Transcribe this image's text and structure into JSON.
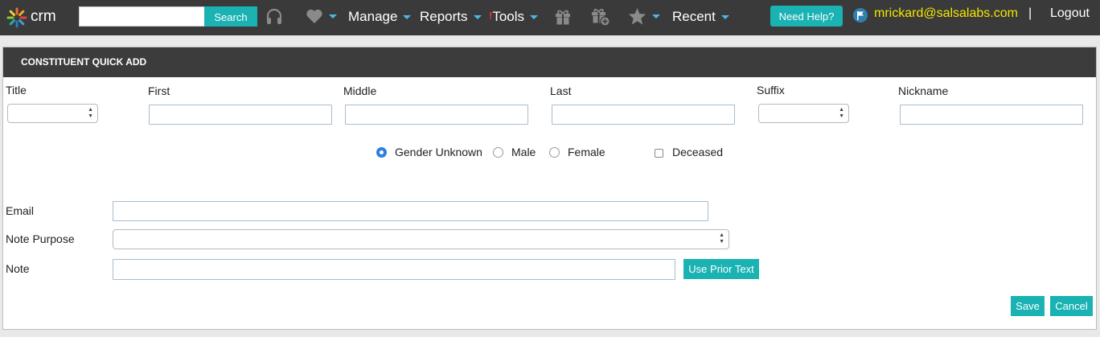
{
  "nav": {
    "logo_text": "crm",
    "search_placeholder": "",
    "search_value": "",
    "search_label": "Search",
    "menu": [
      {
        "label": "Manage"
      },
      {
        "label": "Reports"
      },
      {
        "label": "Tools",
        "alert": "!"
      },
      {
        "label": "Recent"
      }
    ],
    "help_label": "Need Help?",
    "user_email": "mrickard@salsalabs.com",
    "separator": "|",
    "logout_label": "Logout",
    "icons": [
      "headset-icon",
      "heart-icon",
      "gift-icon",
      "gift-add-icon",
      "star-icon",
      "user-flag-icon"
    ]
  },
  "panel": {
    "title": "CONSTITUENT QUICK ADD",
    "name_fields": {
      "title_label": "Title",
      "title_value": "",
      "first_label": "First",
      "first_value": "",
      "middle_label": "Middle",
      "middle_value": "",
      "last_label": "Last",
      "last_value": "",
      "suffix_label": "Suffix",
      "suffix_value": "",
      "nickname_label": "Nickname",
      "nickname_value": ""
    },
    "gender": {
      "options": [
        {
          "label": "Gender Unknown",
          "checked": true
        },
        {
          "label": "Male",
          "checked": false
        },
        {
          "label": "Female",
          "checked": false
        }
      ],
      "deceased_label": "Deceased",
      "deceased_checked": false
    },
    "email_label": "Email",
    "email_value": "",
    "note_purpose_label": "Note Purpose",
    "note_purpose_value": "",
    "note_label": "Note",
    "note_value": "",
    "use_prior_label": "Use Prior Text",
    "save_label": "Save",
    "cancel_label": "Cancel"
  },
  "colors": {
    "accent": "#1ab2b3",
    "nav_bg": "#3a3a3a",
    "email_text": "#f3e600",
    "caret": "#4bb8e8"
  }
}
